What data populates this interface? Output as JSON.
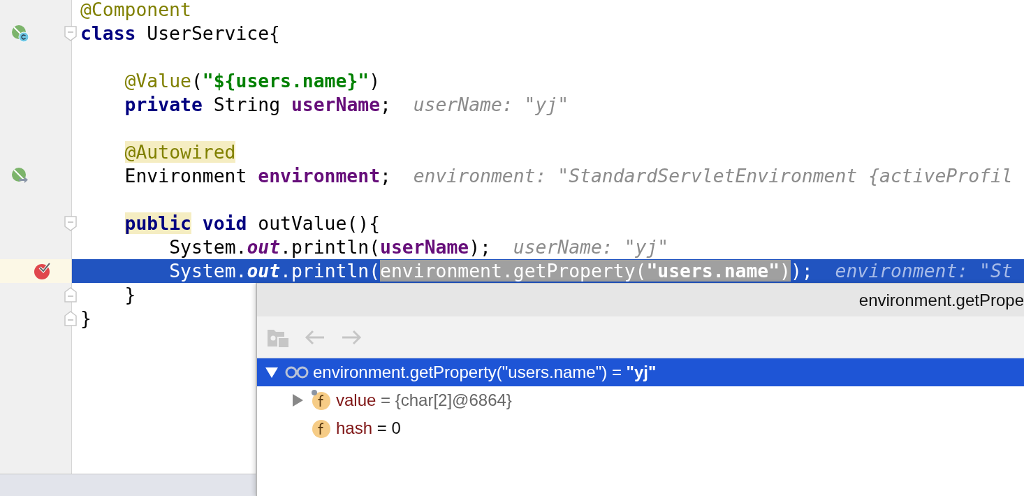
{
  "editor": {
    "lines": [
      {
        "selected": false,
        "tokens": [
          {
            "kind": "annotation",
            "text": "@Component"
          }
        ]
      },
      {
        "marker": {
          "kind": "bean"
        },
        "fold": {
          "kind": "start"
        },
        "selected": false,
        "tokens": [
          {
            "kind": "keyword",
            "text": "class"
          },
          {
            "kind": "plain",
            "text": " UserService{"
          }
        ]
      },
      {
        "selected": false
      },
      {
        "selected": false,
        "tokens": [
          {
            "kind": "annotation",
            "text": "@Value"
          },
          {
            "kind": "plain",
            "text": "("
          },
          {
            "kind": "string",
            "text": "\"${users.name}\""
          },
          {
            "kind": "plain",
            "text": ")"
          }
        ]
      },
      {
        "selected": false,
        "tokens": [
          {
            "kind": "keyword",
            "text": "private"
          },
          {
            "kind": "plain",
            "text": " String "
          },
          {
            "kind": "field",
            "text": "userName"
          },
          {
            "kind": "plain",
            "text": ";"
          }
        ],
        "hint": "userName: \"yj\""
      },
      {
        "selected": false
      },
      {
        "selected": false,
        "tokens": [
          {
            "kind": "annotation",
            "text": "@Autowired",
            "mark": {
              "kind": "usage"
            }
          }
        ]
      },
      {
        "marker": {
          "kind": "injection"
        },
        "selected": false,
        "tokens": [
          {
            "kind": "plain",
            "text": "Environment "
          },
          {
            "kind": "field",
            "text": "environment"
          },
          {
            "kind": "plain",
            "text": ";"
          }
        ],
        "hint": "environment: \"StandardServletEnvironment {activeProfil"
      },
      {
        "selected": false
      },
      {
        "fold": {
          "kind": "start"
        },
        "selected": false,
        "tokens": [
          {
            "kind": "keyword",
            "text": "public",
            "mark": {
              "kind": "usage"
            }
          },
          {
            "kind": "keyword",
            "text": " void"
          },
          {
            "kind": "plain",
            "text": " outValue(){"
          }
        ]
      },
      {
        "selected": false,
        "tokens": [
          {
            "kind": "plain",
            "text": "System."
          },
          {
            "kind": "static-field",
            "text": "out"
          },
          {
            "kind": "plain",
            "text": ".println("
          },
          {
            "kind": "field",
            "text": "userName"
          },
          {
            "kind": "plain",
            "text": ");"
          }
        ],
        "hint": "userName: \"yj\""
      },
      {
        "marker": {
          "kind": "breakpoint"
        },
        "selected": true,
        "tokens": [
          {
            "kind": "plain",
            "text": "System."
          },
          {
            "kind": "static-field",
            "text": "out"
          },
          {
            "kind": "plain",
            "text": ".println("
          },
          {
            "kind": "plain",
            "text": "environment.getProperty(",
            "mark": {
              "kind": "selection"
            }
          },
          {
            "kind": "string",
            "text": "\"users.name\"",
            "mark": {
              "kind": "selection"
            }
          },
          {
            "kind": "plain",
            "text": ")",
            "mark": {
              "kind": "selection"
            }
          },
          {
            "kind": "plain",
            "text": ");"
          }
        ],
        "hint": "environment: \"St"
      },
      {
        "fold": {
          "kind": "end"
        },
        "selected": false,
        "tokens": [
          {
            "kind": "plain",
            "text": "}"
          }
        ]
      },
      {
        "fold": {
          "kind": "end"
        },
        "selected": false,
        "tokens": [
          {
            "kind": "plain",
            "text": "}"
          }
        ]
      }
    ]
  },
  "popup": {
    "title": "environment.getPrope",
    "toolbar": [
      {
        "kind": "watch-folder",
        "disabled": true
      },
      {
        "kind": "back",
        "disabled": true
      },
      {
        "kind": "forward",
        "disabled": true
      }
    ],
    "tree": [
      {
        "kind": "watch",
        "expanded": true,
        "selected": true,
        "label": "environment.getProperty(\"users.name\") = **\"yj\"**",
        "children": [
          {
            "kind": "object-field",
            "expanded": false,
            "selected": false,
            "badge": true,
            "name": "value",
            "value": "= {char[2]@6864}"
          },
          {
            "kind": "primitive-field",
            "selected": false,
            "badge": false,
            "name": "hash",
            "value": "= 0"
          }
        ]
      }
    ]
  }
}
